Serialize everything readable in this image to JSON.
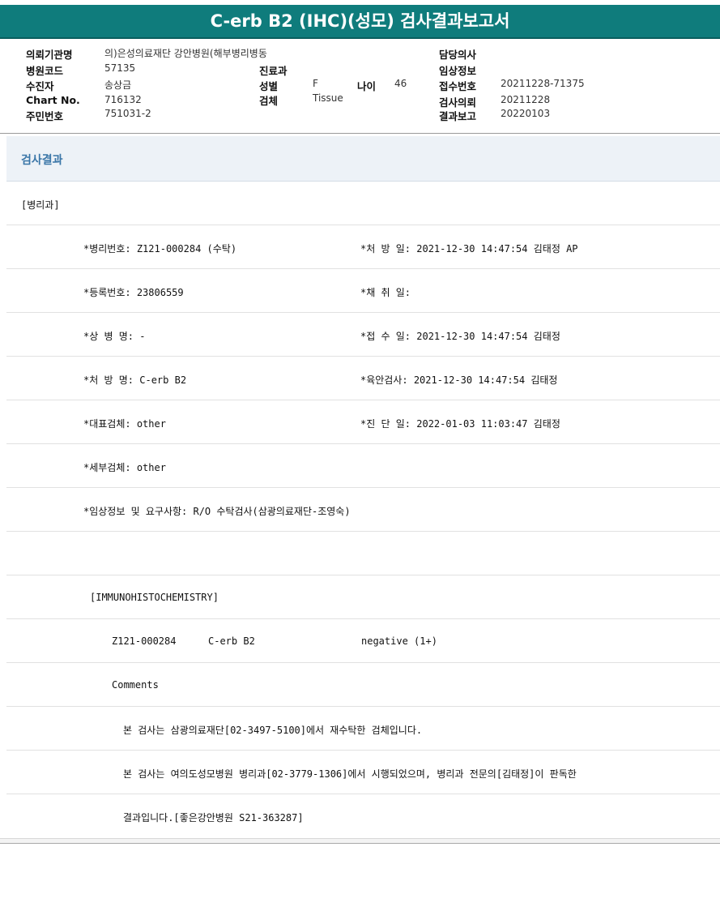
{
  "title": "C-erb B2 (IHC)(성모) 검사결과보고서",
  "header": {
    "institution_label": "의뢰기관명",
    "institution_value": "의)은성의료재단 강안병원(해부병리병동",
    "hospital_code_label": "병원코드",
    "hospital_code_value": "57135",
    "subject_label": "수진자",
    "subject_value": "송상금",
    "chart_label": "Chart No.",
    "chart_value": "716132",
    "rrn_label": "주민번호",
    "rrn_value": "751031-2",
    "dept_label": "진료과",
    "dept_value": "",
    "sex_label": "성별",
    "sex_value": "F",
    "age_label": "나이",
    "age_value": "46",
    "specimen_label": "검체",
    "specimen_value": "Tissue",
    "doctor_label": "담당의사",
    "doctor_value": "",
    "clinical_label": "임상정보",
    "clinical_value": "",
    "receipt_no_label": "접수번호",
    "receipt_no_value": "20211228-71375",
    "request_label": "검사의뢰",
    "request_value": "20211228",
    "report_label": "결과보고",
    "report_value": "20220103"
  },
  "results": {
    "section_title": "검사결과",
    "department": "[병리과]",
    "rows": [
      {
        "left": "*병리번호: Z121-000284 (수탁)",
        "right": "*처 방 일: 2021-12-30 14:47:54  김태정 AP"
      },
      {
        "left": "*등록번호: 23806559",
        "right": "*채 취 일:"
      },
      {
        "left": "*상 병 명: -",
        "right": "*접 수 일: 2021-12-30 14:47:54  김태정"
      },
      {
        "left": "*처 방 명: C-erb B2",
        "right": "*육안검사: 2021-12-30 14:47:54  김태정"
      },
      {
        "left": "*대표검체: other",
        "right": "*진 단 일: 2022-01-03 11:03:47  김태정"
      },
      {
        "left": "*세부검체: other",
        "right": ""
      },
      {
        "left": "*임상정보 및 요구사항: R/O 수탁검사(삼광의료재단-조영숙)",
        "right": ""
      }
    ],
    "ihc_heading": "[IMMUNOHISTOCHEMISTRY]",
    "ihc_result": {
      "case_no": "Z121-000284",
      "marker": "C-erb B2",
      "result": "negative (1+)"
    },
    "comments_label": "Comments",
    "comment_lines": [
      "본 검사는 삼광의료재단[02-3497-5100]에서 재수탁한 검체입니다.",
      "본 검사는 여의도성모병원 병리과[02-3779-1306]에서 시행되었으며, 병리과 전문의[김태정]이 판독한",
      "결과입니다.[좋은강안병원 S21-363287]"
    ]
  }
}
